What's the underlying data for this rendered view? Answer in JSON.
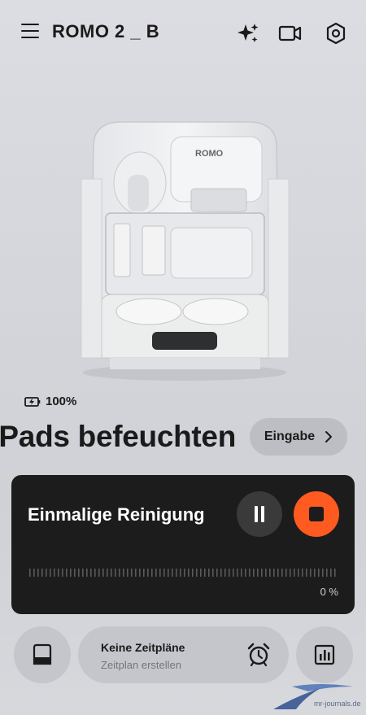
{
  "header": {
    "title": "ROMO 2 _ B",
    "icons": [
      "menu-icon",
      "sparkle-icon",
      "video-icon",
      "settings-icon"
    ]
  },
  "device": {
    "logo_text": "ROMO",
    "battery_text": "100%",
    "status_text": "Pads befeuchten",
    "input_button_label": "Eingabe"
  },
  "cleaning_card": {
    "title": "Einmalige Reinigung",
    "progress_label": "0 %",
    "progress_fraction": 0,
    "controls": [
      "pause-icon",
      "stop-icon"
    ]
  },
  "bottom_bar": {
    "schedule_title": "Keine Zeitpläne",
    "schedule_subtitle": "Zeitplan erstellen"
  },
  "watermark": {
    "text": "mr-journals.de"
  },
  "colors": {
    "accent": "#ff5a1f",
    "card_bg": "#1c1c1c",
    "background": "#d5d7dc"
  }
}
